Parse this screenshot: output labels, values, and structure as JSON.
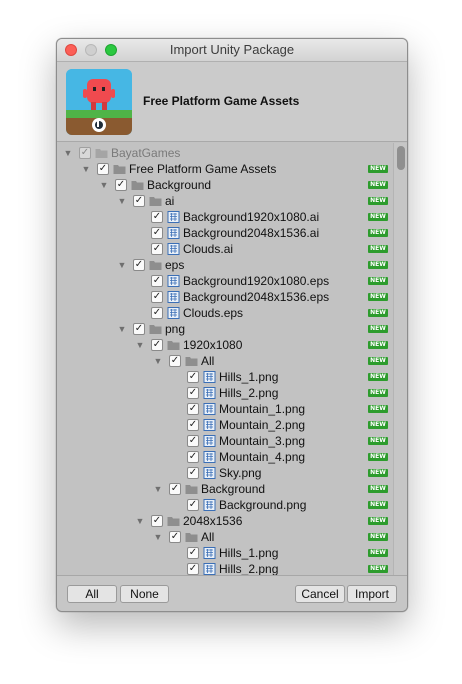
{
  "window": {
    "title": "Import Unity Package"
  },
  "package": {
    "title": "Free Platform Game Assets"
  },
  "colors": {
    "badge": "#2d9c2d",
    "folder": "#8e8e8e",
    "thumbnail_sky": "#46b7e4",
    "thumbnail_grass": "#4fb447",
    "character": "#f04a4f"
  },
  "tree": {
    "new_badge": "NEW",
    "check_mark": "✓",
    "rows": [
      {
        "label": "BayatGames",
        "depth": 0,
        "type": "folder",
        "expanded": true,
        "dim": true,
        "badge": false
      },
      {
        "label": "Free Platform Game Assets",
        "depth": 1,
        "type": "folder",
        "expanded": true,
        "badge": true
      },
      {
        "label": "Background",
        "depth": 2,
        "type": "folder",
        "expanded": true,
        "badge": true
      },
      {
        "label": "ai",
        "depth": 3,
        "type": "folder",
        "expanded": true,
        "badge": true
      },
      {
        "label": "Background1920x1080.ai",
        "depth": 4,
        "type": "file",
        "badge": true
      },
      {
        "label": "Background2048x1536.ai",
        "depth": 4,
        "type": "file",
        "badge": true
      },
      {
        "label": "Clouds.ai",
        "depth": 4,
        "type": "file",
        "badge": true
      },
      {
        "label": "eps",
        "depth": 3,
        "type": "folder",
        "expanded": true,
        "badge": true
      },
      {
        "label": "Background1920x1080.eps",
        "depth": 4,
        "type": "file",
        "badge": true
      },
      {
        "label": "Background2048x1536.eps",
        "depth": 4,
        "type": "file",
        "badge": true
      },
      {
        "label": "Clouds.eps",
        "depth": 4,
        "type": "file",
        "badge": true
      },
      {
        "label": "png",
        "depth": 3,
        "type": "folder",
        "expanded": true,
        "badge": true
      },
      {
        "label": "1920x1080",
        "depth": 4,
        "type": "folder",
        "expanded": true,
        "badge": true
      },
      {
        "label": "All",
        "depth": 5,
        "type": "folder",
        "expanded": true,
        "badge": true
      },
      {
        "label": "Hills_1.png",
        "depth": 6,
        "type": "file",
        "badge": true
      },
      {
        "label": "Hills_2.png",
        "depth": 6,
        "type": "file",
        "badge": true
      },
      {
        "label": "Mountain_1.png",
        "depth": 6,
        "type": "file",
        "badge": true
      },
      {
        "label": "Mountain_2.png",
        "depth": 6,
        "type": "file",
        "badge": true
      },
      {
        "label": "Mountain_3.png",
        "depth": 6,
        "type": "file",
        "badge": true
      },
      {
        "label": "Mountain_4.png",
        "depth": 6,
        "type": "file",
        "badge": true
      },
      {
        "label": "Sky.png",
        "depth": 6,
        "type": "file",
        "badge": true
      },
      {
        "label": "Background",
        "depth": 5,
        "type": "folder",
        "expanded": true,
        "badge": true
      },
      {
        "label": "Background.png",
        "depth": 6,
        "type": "file",
        "badge": true
      },
      {
        "label": "2048x1536",
        "depth": 4,
        "type": "folder",
        "expanded": true,
        "badge": true
      },
      {
        "label": "All",
        "depth": 5,
        "type": "folder",
        "expanded": true,
        "badge": true
      },
      {
        "label": "Hills_1.png",
        "depth": 6,
        "type": "file",
        "badge": true
      },
      {
        "label": "Hills_2.png",
        "depth": 6,
        "type": "file",
        "badge": true
      }
    ]
  },
  "footer": {
    "all_label": "All",
    "none_label": "None",
    "cancel_label": "Cancel",
    "import_label": "Import"
  }
}
